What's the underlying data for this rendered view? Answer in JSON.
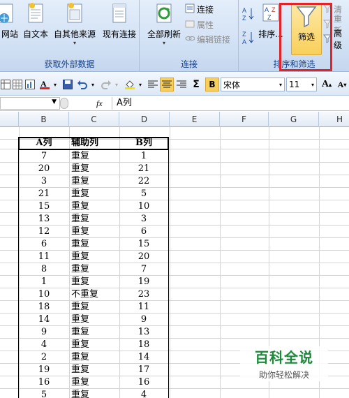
{
  "ribbon": {
    "external_data": {
      "group_label": "获取外部数据",
      "buttons": [
        "网站",
        "自文本",
        "自其他来源",
        "现有连接"
      ]
    },
    "connections": {
      "group_label": "连接",
      "refresh_all": "全部刷新",
      "connections": "连接",
      "properties": "属性",
      "edit_links": "编辑链接"
    },
    "sort_filter": {
      "group_label": "排序和筛选",
      "sort": "排序...",
      "filter": "筛选",
      "clear": "清",
      "reapply": "重新",
      "advanced": "高级"
    }
  },
  "toolbar": {
    "bold": "B",
    "font_name": "宋体",
    "font_size": "11",
    "sum": "Σ"
  },
  "formula_bar": {
    "fx": "fx",
    "content": "A列"
  },
  "columns": [
    "B",
    "C",
    "D",
    "E",
    "F",
    "G",
    "H"
  ],
  "table": {
    "headers": [
      "A列",
      "辅助列",
      "B列"
    ],
    "rows": [
      [
        "7",
        "重复",
        "1"
      ],
      [
        "20",
        "重复",
        "21"
      ],
      [
        "3",
        "重复",
        "22"
      ],
      [
        "21",
        "重复",
        "5"
      ],
      [
        "15",
        "重复",
        "10"
      ],
      [
        "13",
        "重复",
        "3"
      ],
      [
        "12",
        "重复",
        "6"
      ],
      [
        "6",
        "重复",
        "15"
      ],
      [
        "11",
        "重复",
        "20"
      ],
      [
        "8",
        "重复",
        "7"
      ],
      [
        "1",
        "重复",
        "19"
      ],
      [
        "10",
        "不重复",
        "23"
      ],
      [
        "18",
        "重复",
        "11"
      ],
      [
        "14",
        "重复",
        "9"
      ],
      [
        "9",
        "重复",
        "13"
      ],
      [
        "4",
        "重复",
        "18"
      ],
      [
        "2",
        "重复",
        "14"
      ],
      [
        "19",
        "重复",
        "17"
      ],
      [
        "16",
        "重复",
        "16"
      ],
      [
        "5",
        "重复",
        "4"
      ]
    ]
  },
  "watermark": {
    "title": "百科全说",
    "subtitle": "助你轻松解决"
  },
  "colors": {
    "highlight": "#e52226",
    "ribbon_label": "#15428b",
    "watermark": "#1a8a3a"
  }
}
